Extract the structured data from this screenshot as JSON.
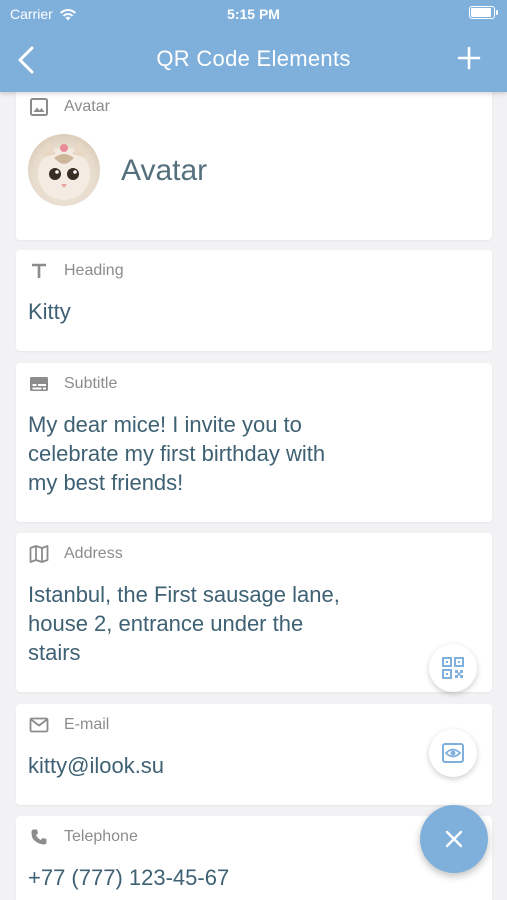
{
  "status_bar": {
    "carrier": "Carrier",
    "time": "5:15 PM"
  },
  "nav": {
    "title": "QR Code Elements",
    "back_icon": "chevron-left-icon",
    "add_icon": "plus-icon"
  },
  "cards": {
    "avatar": {
      "label": "Avatar",
      "value": "Avatar",
      "icon": "image-icon"
    },
    "heading": {
      "label": "Heading",
      "value": "Kitty",
      "icon": "text-icon"
    },
    "subtitle": {
      "label": "Subtitle",
      "value": "My dear mice! I invite you to\ncelebrate my first birthday with\nmy best friends!",
      "icon": "subtitles-icon"
    },
    "address": {
      "label": "Address",
      "value": "Istanbul, the First sausage lane,\nhouse 2, entrance under the\nstairs",
      "icon": "map-icon"
    },
    "email": {
      "label": "E-mail",
      "value": "kitty@ilook.su",
      "icon": "mail-icon"
    },
    "phone": {
      "label": "Telephone",
      "value": "+77 (777) 123-45-67",
      "icon": "phone-icon"
    }
  },
  "fabs": {
    "qr": "qr-code-icon",
    "preview": "eye-icon",
    "close": "close-icon"
  },
  "colors": {
    "accent": "#7fb0dc",
    "value_text": "#3e6173",
    "label_text": "#8c8c8c"
  }
}
